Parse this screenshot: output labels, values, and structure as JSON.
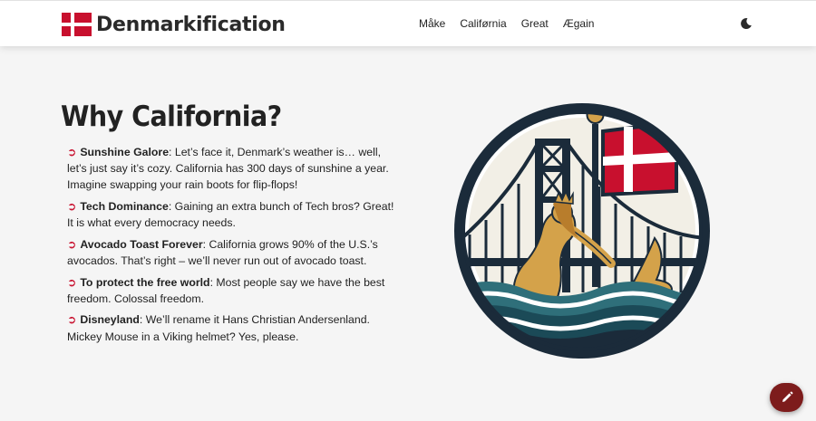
{
  "header": {
    "brand_name": "Denmarkification",
    "nav": [
      "Måke",
      "Califørnia",
      "Great",
      "Ægain"
    ]
  },
  "icons": {
    "brand": "danish-flag-icon",
    "theme": "moon-icon",
    "fab": "pencil-icon",
    "bullet": "curved-arrow"
  },
  "main": {
    "heading": "Why California?",
    "bullet_symbol": "➲",
    "reasons": [
      {
        "title": "Sunshine Galore",
        "text": ": Let’s face it, Denmark’s weather is… well, let’s just say it’s cozy. California has 300 days of sunshine a year. Imagine swapping your rain boots for flip-flops!"
      },
      {
        "title": "Tech Dominance",
        "text": ": Gaining an extra bunch of Tech bros? Great! It is what every democracy needs."
      },
      {
        "title": "Avocado Toast Forever",
        "text": ": California grows 90% of the U.S.’s avocados. That’s right – we’ll never run out of avocado toast."
      },
      {
        "title": "To protect the free world",
        "text": ": Most people say we have the best freedom. Colossal freedom."
      },
      {
        "title": "Disneyland",
        "text": ": We’ll rename it Hans Christian Andersenland. Mickey Mouse in a Viking helmet? Yes, please."
      }
    ]
  },
  "colors": {
    "danish_red": "#c8102e",
    "navy": "#1b2b3a",
    "teal": "#2f6f7a",
    "gold": "#d4a24a",
    "fab": "#7d1c1c"
  }
}
